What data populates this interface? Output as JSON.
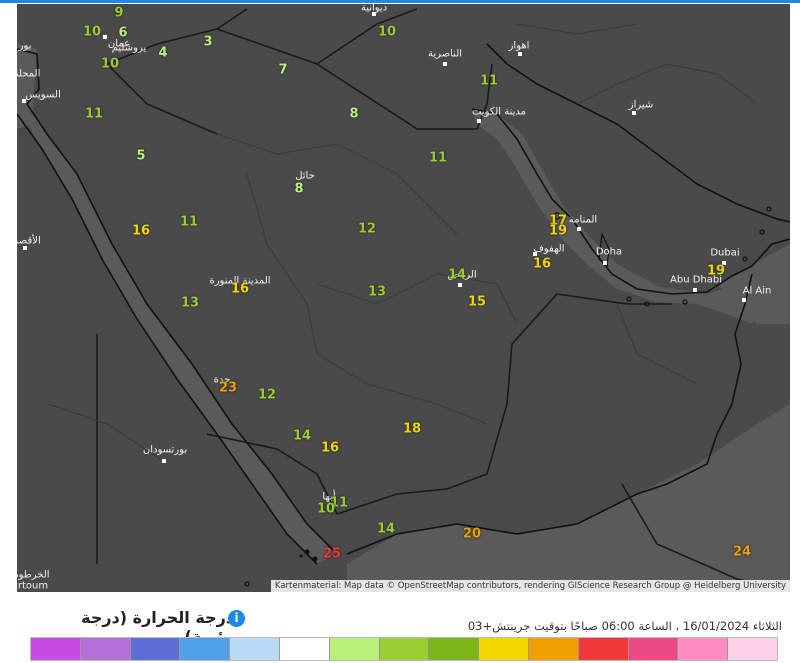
{
  "attribution": "Kartenmaterial: Map data © OpenStreetMap contributors, rendering GIScience Research Group @ Heidelberg University",
  "legend": {
    "title": "درجة الحرارة (درجة مئوية)",
    "info_icon": "info-icon",
    "timestamp": "الثلاثاء 16/01/2024 ، الساعة 06:00 صباحًا بتوقيت جرينتش+03",
    "colors": [
      "#c84be6",
      "#b56fd6",
      "#5d6fd6",
      "#4fa0e8",
      "#b9dcf6",
      "#ffffff",
      "#b8f07a",
      "#9acd32",
      "#7cb518",
      "#f2d600",
      "#f0a000",
      "#f03a3a",
      "#ee4a86",
      "#ff8cc2",
      "#ffd0ea"
    ]
  },
  "cities": [
    {
      "id": "amman",
      "label": "عمان"
    },
    {
      "id": "jerusalem",
      "label": "يروشليم"
    },
    {
      "id": "bayrut",
      "label": "بور"
    },
    {
      "id": "mahalla",
      "label": "المحلة"
    },
    {
      "id": "suez",
      "label": "السويس"
    },
    {
      "id": "nasiriyah",
      "label": "الناصرية"
    },
    {
      "id": "ahvaz",
      "label": "اهواز"
    },
    {
      "id": "kuwait",
      "label": "مدينة الكويت"
    },
    {
      "id": "shiraz",
      "label": "شيراز"
    },
    {
      "id": "hail",
      "label": "حائل"
    },
    {
      "id": "manama",
      "label": "المنامة"
    },
    {
      "id": "hofuf",
      "label": "الهفوف"
    },
    {
      "id": "doha",
      "label": "Doha"
    },
    {
      "id": "dubai",
      "label": "Dubai"
    },
    {
      "id": "abudhabi",
      "label": "Abu Dhabi"
    },
    {
      "id": "alain",
      "label": "Al Ain"
    },
    {
      "id": "riyadh",
      "label": "الرياض"
    },
    {
      "id": "madinah",
      "label": "المدينة المنورة"
    },
    {
      "id": "jeddah",
      "label": "جدة"
    },
    {
      "id": "portsudan",
      "label": "بورتسودان"
    },
    {
      "id": "abha",
      "label": "أبها"
    },
    {
      "id": "luxor",
      "label": "الأقصر"
    },
    {
      "id": "khartoum",
      "label": "الخرطوم"
    },
    {
      "id": "khartoum_en",
      "label": "rtoum"
    },
    {
      "id": "diwaniyah",
      "label": "ديوانية"
    }
  ],
  "temperatures": [
    {
      "id": "t1",
      "value": "9",
      "color": "#9acd32"
    },
    {
      "id": "t2",
      "value": "10",
      "color": "#9acd32"
    },
    {
      "id": "t3",
      "value": "6",
      "color": "#b8f07a"
    },
    {
      "id": "t4",
      "value": "4",
      "color": "#b8f07a"
    },
    {
      "id": "t5",
      "value": "3",
      "color": "#b8f07a"
    },
    {
      "id": "t6",
      "value": "10",
      "color": "#9acd32"
    },
    {
      "id": "t7",
      "value": "10",
      "color": "#9acd32"
    },
    {
      "id": "t8",
      "value": "7",
      "color": "#b8f07a"
    },
    {
      "id": "t9",
      "value": "11",
      "color": "#9acd32"
    },
    {
      "id": "t10",
      "value": "8",
      "color": "#b8f07a"
    },
    {
      "id": "t11",
      "value": "11",
      "color": "#9acd32"
    },
    {
      "id": "t12",
      "value": "5",
      "color": "#b8f07a"
    },
    {
      "id": "t13",
      "value": "11",
      "color": "#9acd32"
    },
    {
      "id": "t14",
      "value": "8",
      "color": "#b8f07a"
    },
    {
      "id": "t15",
      "value": "16",
      "color": "#f2d600"
    },
    {
      "id": "t16",
      "value": "11",
      "color": "#9acd32"
    },
    {
      "id": "t17",
      "value": "12",
      "color": "#9acd32"
    },
    {
      "id": "t18",
      "value": "17",
      "color": "#f2d600"
    },
    {
      "id": "t19",
      "value": "19",
      "color": "#f2d600"
    },
    {
      "id": "t20",
      "value": "16",
      "color": "#f2d600"
    },
    {
      "id": "t21",
      "value": "14",
      "color": "#9acd32"
    },
    {
      "id": "t22",
      "value": "15",
      "color": "#f2d600"
    },
    {
      "id": "t23",
      "value": "19",
      "color": "#f2d600"
    },
    {
      "id": "t24",
      "value": "13",
      "color": "#9acd32"
    },
    {
      "id": "t25",
      "value": "16",
      "color": "#f2d600"
    },
    {
      "id": "t26",
      "value": "13",
      "color": "#9acd32"
    },
    {
      "id": "t27",
      "value": "23",
      "color": "#f0a000"
    },
    {
      "id": "t28",
      "value": "12",
      "color": "#9acd32"
    },
    {
      "id": "t29",
      "value": "18",
      "color": "#f2d600"
    },
    {
      "id": "t30",
      "value": "14",
      "color": "#9acd32"
    },
    {
      "id": "t31",
      "value": "16",
      "color": "#f2d600"
    },
    {
      "id": "t32",
      "value": "11",
      "color": "#9acd32"
    },
    {
      "id": "t33",
      "value": "10",
      "color": "#9acd32"
    },
    {
      "id": "t34",
      "value": "14",
      "color": "#9acd32"
    },
    {
      "id": "t35",
      "value": "20",
      "color": "#f0a000"
    },
    {
      "id": "t36",
      "value": "25",
      "color": "#f03a3a"
    },
    {
      "id": "t37",
      "value": "24",
      "color": "#f0a000"
    }
  ]
}
